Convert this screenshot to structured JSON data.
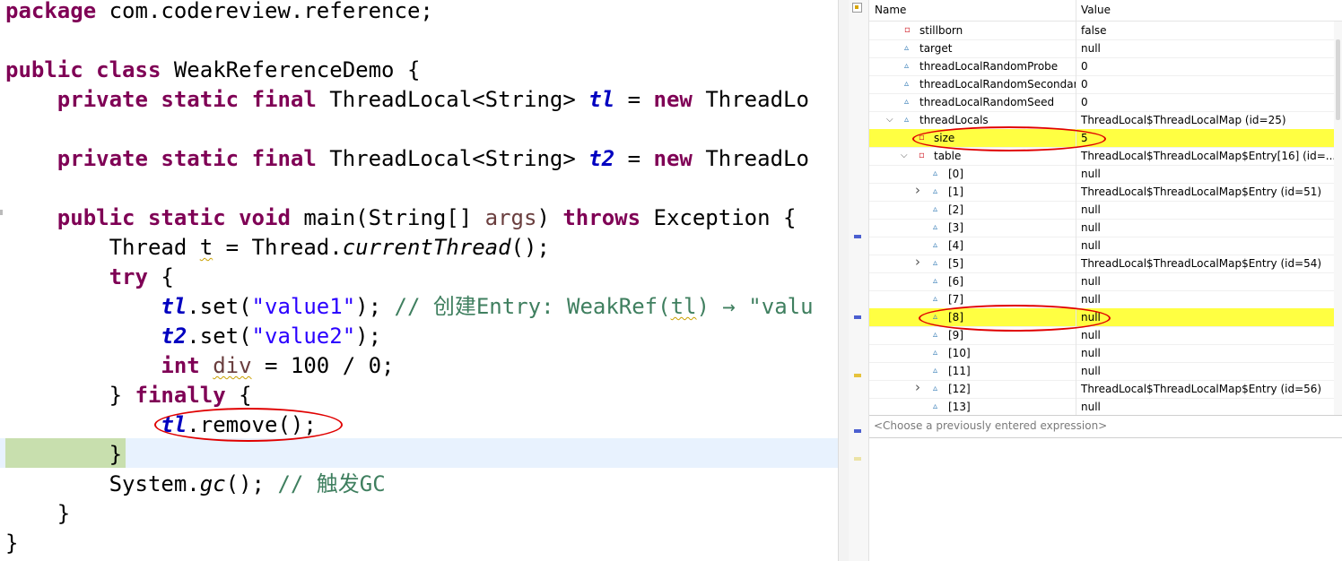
{
  "editor": {
    "lines": [
      {
        "parts": [
          {
            "t": "package",
            "c": "kw"
          },
          {
            "t": " com.codereview.reference;"
          }
        ]
      },
      {
        "parts": []
      },
      {
        "parts": [
          {
            "t": "public",
            "c": "kw"
          },
          {
            "t": " "
          },
          {
            "t": "class",
            "c": "kw"
          },
          {
            "t": " WeakReferenceDemo {"
          }
        ]
      },
      {
        "parts": [
          {
            "t": "    "
          },
          {
            "t": "private",
            "c": "kw"
          },
          {
            "t": " "
          },
          {
            "t": "static",
            "c": "kw"
          },
          {
            "t": " "
          },
          {
            "t": "final",
            "c": "kw"
          },
          {
            "t": " ThreadLocal<String> "
          },
          {
            "t": "tl",
            "c": "fld"
          },
          {
            "t": " = "
          },
          {
            "t": "new",
            "c": "kw"
          },
          {
            "t": " ThreadLo"
          }
        ]
      },
      {
        "parts": []
      },
      {
        "parts": [
          {
            "t": "    "
          },
          {
            "t": "private",
            "c": "kw"
          },
          {
            "t": " "
          },
          {
            "t": "static",
            "c": "kw"
          },
          {
            "t": " "
          },
          {
            "t": "final",
            "c": "kw"
          },
          {
            "t": " ThreadLocal<String> "
          },
          {
            "t": "t2",
            "c": "fld"
          },
          {
            "t": " = "
          },
          {
            "t": "new",
            "c": "kw"
          },
          {
            "t": " ThreadLo"
          }
        ]
      },
      {
        "parts": []
      },
      {
        "parts": [
          {
            "t": "    "
          },
          {
            "t": "public",
            "c": "kw"
          },
          {
            "t": " "
          },
          {
            "t": "static",
            "c": "kw"
          },
          {
            "t": " "
          },
          {
            "t": "void",
            "c": "kw"
          },
          {
            "t": " main(String[] "
          },
          {
            "t": "args",
            "c": "param"
          },
          {
            "t": ") "
          },
          {
            "t": "throws",
            "c": "kw"
          },
          {
            "t": " Exception {"
          }
        ]
      },
      {
        "parts": [
          {
            "t": "        Thread "
          },
          {
            "t": "t",
            "c": "warn"
          },
          {
            "t": " = Thread."
          },
          {
            "t": "currentThread",
            "c": "it"
          },
          {
            "t": "();"
          }
        ]
      },
      {
        "parts": [
          {
            "t": "        "
          },
          {
            "t": "try",
            "c": "kw"
          },
          {
            "t": " {"
          }
        ]
      },
      {
        "parts": [
          {
            "t": "            "
          },
          {
            "t": "tl",
            "c": "fld"
          },
          {
            "t": ".set("
          },
          {
            "t": "\"value1\"",
            "c": "str"
          },
          {
            "t": "); "
          },
          {
            "t": "// 创建Entry: WeakRef(",
            "c": "cmt"
          },
          {
            "t": "tl",
            "c": "cmt warn"
          },
          {
            "t": ") → \"valu",
            "c": "cmt"
          }
        ]
      },
      {
        "parts": [
          {
            "t": "            "
          },
          {
            "t": "t2",
            "c": "fld"
          },
          {
            "t": ".set("
          },
          {
            "t": "\"value2\"",
            "c": "str"
          },
          {
            "t": ");"
          }
        ]
      },
      {
        "parts": [
          {
            "t": "            "
          },
          {
            "t": "int",
            "c": "kw"
          },
          {
            "t": " "
          },
          {
            "t": "div",
            "c": "param warn"
          },
          {
            "t": " = 100 / 0;"
          }
        ]
      },
      {
        "parts": [
          {
            "t": "        } "
          },
          {
            "t": "finally",
            "c": "kw"
          },
          {
            "t": " {"
          }
        ]
      },
      {
        "parts": [
          {
            "t": "            "
          },
          {
            "t": "tl",
            "c": "fld"
          },
          {
            "t": ".remove();"
          }
        ]
      },
      {
        "parts": [
          {
            "t": "        }"
          }
        ]
      },
      {
        "parts": [
          {
            "t": "        System."
          },
          {
            "t": "gc",
            "c": "it"
          },
          {
            "t": "(); "
          },
          {
            "t": "// 触发GC",
            "c": "cmt"
          }
        ]
      },
      {
        "parts": [
          {
            "t": "    }"
          }
        ]
      },
      {
        "parts": [
          {
            "t": "}"
          }
        ]
      }
    ]
  },
  "variables": {
    "header": {
      "name": "Name",
      "value": "Value"
    },
    "rows": [
      {
        "depth": 0,
        "icon": "private-field-icon",
        "name": "stillborn",
        "value": "false"
      },
      {
        "depth": 0,
        "icon": "package-field-icon",
        "name": "target",
        "value": "null"
      },
      {
        "depth": 0,
        "icon": "package-field-icon",
        "name": "threadLocalRandomProbe",
        "value": "0"
      },
      {
        "depth": 0,
        "icon": "package-field-icon",
        "name": "threadLocalRandomSecondarySeed",
        "value": "0"
      },
      {
        "depth": 0,
        "icon": "package-field-icon",
        "name": "threadLocalRandomSeed",
        "value": "0"
      },
      {
        "depth": 0,
        "icon": "package-field-icon",
        "name": "threadLocals",
        "value": "ThreadLocal$ThreadLocalMap  (id=25)",
        "twisty": "expanded"
      },
      {
        "depth": 1,
        "icon": "private-field-icon",
        "name": "size",
        "value": "5",
        "highlight": true
      },
      {
        "depth": 1,
        "icon": "private-field-icon",
        "name": "table",
        "value": "ThreadLocal$ThreadLocalMap$Entry[16]  (id=...",
        "twisty": "expanded"
      },
      {
        "depth": 2,
        "icon": "package-field-icon",
        "name": "[0]",
        "value": "null"
      },
      {
        "depth": 2,
        "icon": "package-field-icon",
        "name": "[1]",
        "value": "ThreadLocal$ThreadLocalMap$Entry  (id=51)",
        "twisty": "collapsed"
      },
      {
        "depth": 2,
        "icon": "package-field-icon",
        "name": "[2]",
        "value": "null"
      },
      {
        "depth": 2,
        "icon": "package-field-icon",
        "name": "[3]",
        "value": "null"
      },
      {
        "depth": 2,
        "icon": "package-field-icon",
        "name": "[4]",
        "value": "null"
      },
      {
        "depth": 2,
        "icon": "package-field-icon",
        "name": "[5]",
        "value": "ThreadLocal$ThreadLocalMap$Entry  (id=54)",
        "twisty": "collapsed"
      },
      {
        "depth": 2,
        "icon": "package-field-icon",
        "name": "[6]",
        "value": "null"
      },
      {
        "depth": 2,
        "icon": "package-field-icon",
        "name": "[7]",
        "value": "null"
      },
      {
        "depth": 2,
        "icon": "package-field-icon",
        "name": "[8]",
        "value": "null",
        "highlight": true
      },
      {
        "depth": 2,
        "icon": "package-field-icon",
        "name": "[9]",
        "value": "null"
      },
      {
        "depth": 2,
        "icon": "package-field-icon",
        "name": "[10]",
        "value": "null"
      },
      {
        "depth": 2,
        "icon": "package-field-icon",
        "name": "[11]",
        "value": "null"
      },
      {
        "depth": 2,
        "icon": "package-field-icon",
        "name": "[12]",
        "value": "ThreadLocal$ThreadLocalMap$Entry  (id=56)",
        "twisty": "collapsed"
      },
      {
        "depth": 2,
        "icon": "package-field-icon",
        "name": "[13]",
        "value": "null"
      }
    ],
    "expression_placeholder": "<Choose a previously entered expression>"
  },
  "colors": {
    "keyword": "#7f0055",
    "field": "#0000c0",
    "string": "#2a00ff",
    "comment": "#3f7f5f",
    "highlight": "#ffff42",
    "annotation_circle": "#e00000"
  }
}
